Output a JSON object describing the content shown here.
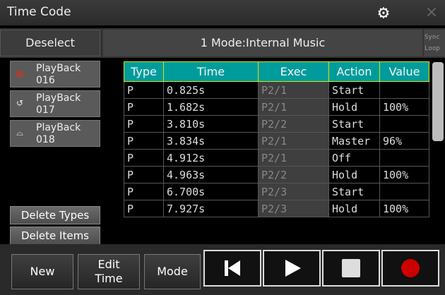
{
  "window": {
    "title": "Time Code",
    "settings_icon": "gear-icon",
    "close_icon": "close-icon",
    "close_glyph": "×"
  },
  "toolbar": {
    "deselect_label": "Deselect",
    "mode_text": "1  Mode:Internal Music",
    "sync_label": "Sync",
    "loop_label": "Loop"
  },
  "playbacks": [
    {
      "label": "PlayBack",
      "number": "016",
      "icon": "fixture-icon",
      "icon_glyph": "▦",
      "icon_color": "#c0392b"
    },
    {
      "label": "PlayBack",
      "number": "017",
      "icon": "rotate-icon",
      "icon_glyph": "↺",
      "icon_color": "#dddddd"
    },
    {
      "label": "PlayBack",
      "number": "018",
      "icon": "lamp-icon",
      "icon_glyph": "⌓",
      "icon_color": "#dddddd"
    }
  ],
  "side_buttons": {
    "delete_types": "Delete Types",
    "delete_items": "Delete Items"
  },
  "table": {
    "columns": [
      "Type",
      "Time",
      "Exec",
      "Action",
      "Value"
    ],
    "rows": [
      [
        "P",
        "0.825s",
        "P2/1",
        "Start",
        ""
      ],
      [
        "P",
        "1.682s",
        "P2/1",
        "Hold",
        "100%"
      ],
      [
        "P",
        "3.810s",
        "P2/2",
        "Start",
        ""
      ],
      [
        "P",
        "3.834s",
        "P2/1",
        "Master",
        "96%"
      ],
      [
        "P",
        "4.912s",
        "P2/1",
        "Off",
        ""
      ],
      [
        "P",
        "4.963s",
        "P2/2",
        "Hold",
        "100%"
      ],
      [
        "P",
        "6.700s",
        "P2/3",
        "Start",
        ""
      ],
      [
        "P",
        "7.927s",
        "P2/3",
        "Hold",
        "100%"
      ]
    ]
  },
  "bottom": {
    "new_label": "New",
    "edit_time_line1": "Edit",
    "edit_time_line2": "Time",
    "mode_label": "Mode",
    "transport": [
      {
        "name": "skip-to-start-icon"
      },
      {
        "name": "play-icon"
      },
      {
        "name": "stop-icon"
      },
      {
        "name": "record-icon",
        "color": "#cc0000"
      }
    ]
  },
  "colors": {
    "header_bg": "#009c9c",
    "header_border": "#e0e000",
    "record": "#cc0000"
  }
}
